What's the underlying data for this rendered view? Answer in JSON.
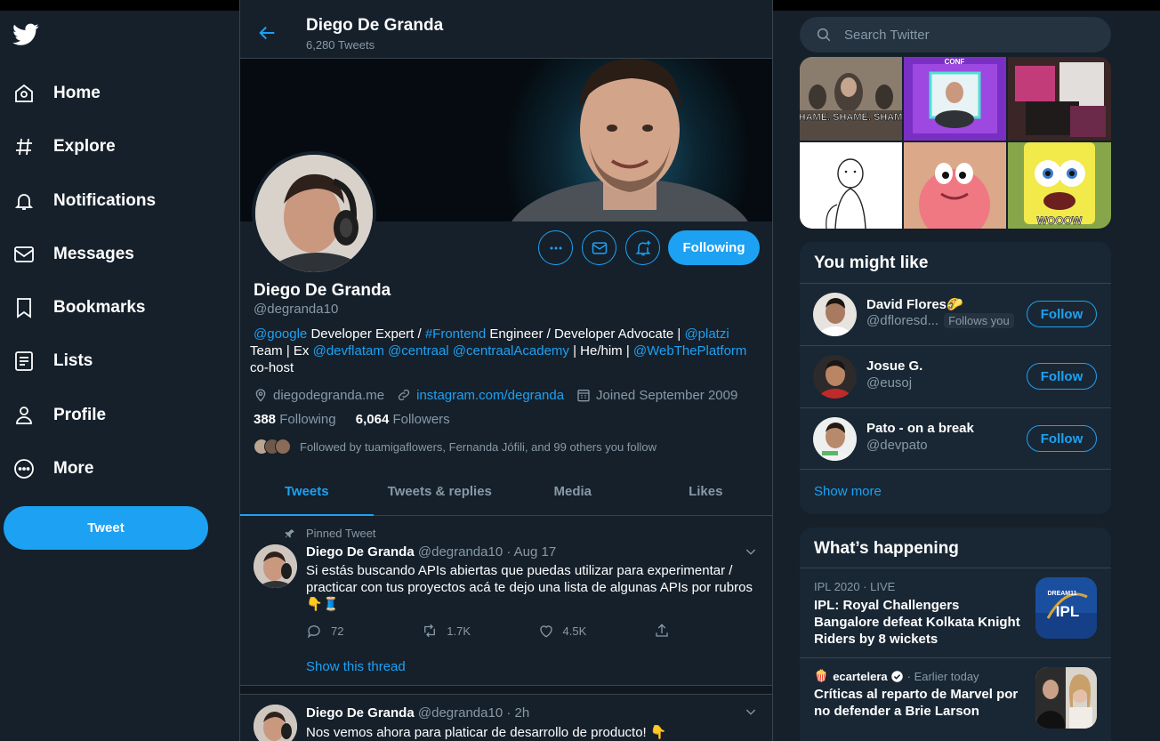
{
  "colors": {
    "accent": "#1da1f2",
    "background": "#15202b",
    "panel": "#192734",
    "border": "#38444d",
    "secondary_text": "#8899a6"
  },
  "sidebar": {
    "logo_icon": "twitter-bird-icon",
    "items": [
      {
        "label": "Home",
        "icon": "home-icon"
      },
      {
        "label": "Explore",
        "icon": "hashtag-icon"
      },
      {
        "label": "Notifications",
        "icon": "bell-icon"
      },
      {
        "label": "Messages",
        "icon": "envelope-icon"
      },
      {
        "label": "Bookmarks",
        "icon": "bookmark-icon"
      },
      {
        "label": "Lists",
        "icon": "list-icon"
      },
      {
        "label": "Profile",
        "icon": "person-icon"
      },
      {
        "label": "More",
        "icon": "more-circle-icon"
      }
    ],
    "tweet_button": "Tweet"
  },
  "header": {
    "name": "Diego De Granda",
    "tweet_count": "6,280 Tweets"
  },
  "profile": {
    "name": "Diego De Granda",
    "handle": "@degranda10",
    "following_button": "Following",
    "bio": {
      "p1": "@google",
      "p2": " Developer Expert / ",
      "p3": "#Frontend",
      "p4": " Engineer / Developer Advocate | ",
      "p5": "@platzi",
      "p6": " Team | Ex ",
      "p7": "@devflatam",
      "p8": " ",
      "p9": "@centraal",
      "p10": " ",
      "p11": "@centraalAcademy",
      "p12": " | He/him | ",
      "p13": "@WebThePlatform",
      "p14": " co-host"
    },
    "location": "diegodegranda.me",
    "website": "instagram.com/degranda",
    "joined": "Joined September 2009",
    "following_count": "388",
    "following_label": "Following",
    "followers_count": "6,064",
    "followers_label": "Followers",
    "followed_by": "Followed by tuamigaflowers, Fernanda Jófili, and 99 others you follow"
  },
  "tabs": [
    "Tweets",
    "Tweets & replies",
    "Media",
    "Likes"
  ],
  "tweets": [
    {
      "pinned_label": "Pinned Tweet",
      "name": "Diego De Granda",
      "meta": "@degranda10 · Aug 17",
      "text": "Si estás buscando APIs abiertas que puedas utilizar para experimentar / practicar con tus proyectos acá te dejo una lista de algunas APIs por rubros 👇🧵",
      "replies": "72",
      "retweets": "1.7K",
      "likes": "4.5K",
      "show_thread": "Show this thread"
    },
    {
      "name": "Diego De Granda",
      "meta": "@degranda10 · 2h",
      "text": "Nos vemos ahora para platicar de desarrollo de producto! 👇"
    }
  ],
  "search": {
    "placeholder": "Search Twitter"
  },
  "media_grid": {
    "shame_text": "HAME. SHAME. SHAM",
    "conf_text": "CONF",
    "wooow_text": "WOOOW"
  },
  "who_to_follow": {
    "title": "You might like",
    "users": [
      {
        "name": "David Flores🌮",
        "handle": "@dfloresd...",
        "follows_you": "Follows you",
        "button": "Follow"
      },
      {
        "name": "Josue G.",
        "handle": "@eusoj",
        "button": "Follow"
      },
      {
        "name": "Pato - on a break",
        "handle": "@devpato",
        "button": "Follow"
      }
    ],
    "show_more": "Show more"
  },
  "trends": {
    "title": "What’s happening",
    "items": [
      {
        "meta": "IPL 2020 · LIVE",
        "title": "IPL: Royal Challengers Bangalore defeat Kolkata Knight Riders by 8 wickets",
        "image_text": "IPL",
        "image_subtext": "DREAM11"
      },
      {
        "source": "ecartelera",
        "time": "· Earlier today",
        "title": "Críticas al reparto de Marvel por no defender a Brie Larson"
      }
    ]
  }
}
